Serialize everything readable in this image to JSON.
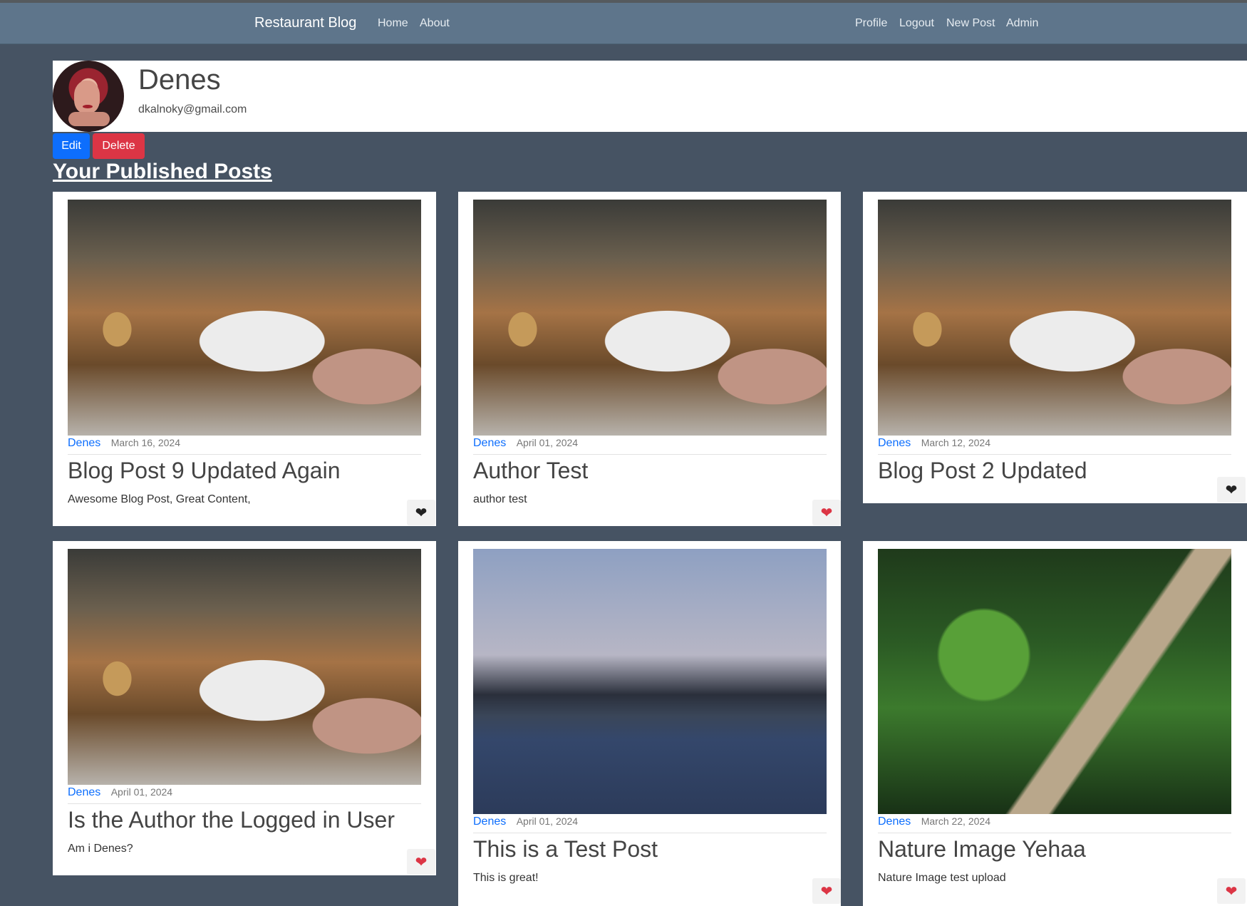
{
  "navbar": {
    "brand": "Restaurant Blog",
    "left_links": [
      "Home",
      "About"
    ],
    "right_links": [
      "Profile",
      "Logout",
      "New Post",
      "Admin"
    ]
  },
  "profile": {
    "name": "Denes",
    "email": "dkalnoky@gmail.com",
    "edit_label": "Edit",
    "delete_label": "Delete"
  },
  "section_title": "Your Published Posts",
  "posts": [
    {
      "author": "Denes",
      "date": "March 16, 2024",
      "title": "Blog Post 9 Updated Again",
      "excerpt": "Awesome Blog Post, Great Content,",
      "liked": false,
      "heart_icon": "heart-icon"
    },
    {
      "author": "Denes",
      "date": "April 01, 2024",
      "title": "Author Test",
      "excerpt": "author test",
      "liked": true,
      "heart_icon": "heart-icon"
    },
    {
      "author": "Denes",
      "date": "March 12, 2024",
      "title": "Blog Post 2 Updated",
      "excerpt": "",
      "liked": false,
      "heart_icon": "heart-icon"
    },
    {
      "author": "Denes",
      "date": "April 01, 2024",
      "title": "Is the Author the Logged in User",
      "excerpt": "Am i Denes?",
      "liked": true,
      "heart_icon": "heart-icon"
    },
    {
      "author": "Denes",
      "date": "April 01, 2024",
      "title": "This is a Test Post",
      "excerpt": "This is great!",
      "liked": true,
      "heart_icon": "heart-icon"
    },
    {
      "author": "Denes",
      "date": "March 22, 2024",
      "title": "Nature Image Yehaa",
      "excerpt": "Nature Image test upload",
      "liked": true,
      "heart_icon": "heart-icon"
    }
  ],
  "colors": {
    "page_bg": "#465363",
    "navbar_bg": "#5e758b",
    "primary": "#0d6efd",
    "danger": "#dc3545"
  }
}
